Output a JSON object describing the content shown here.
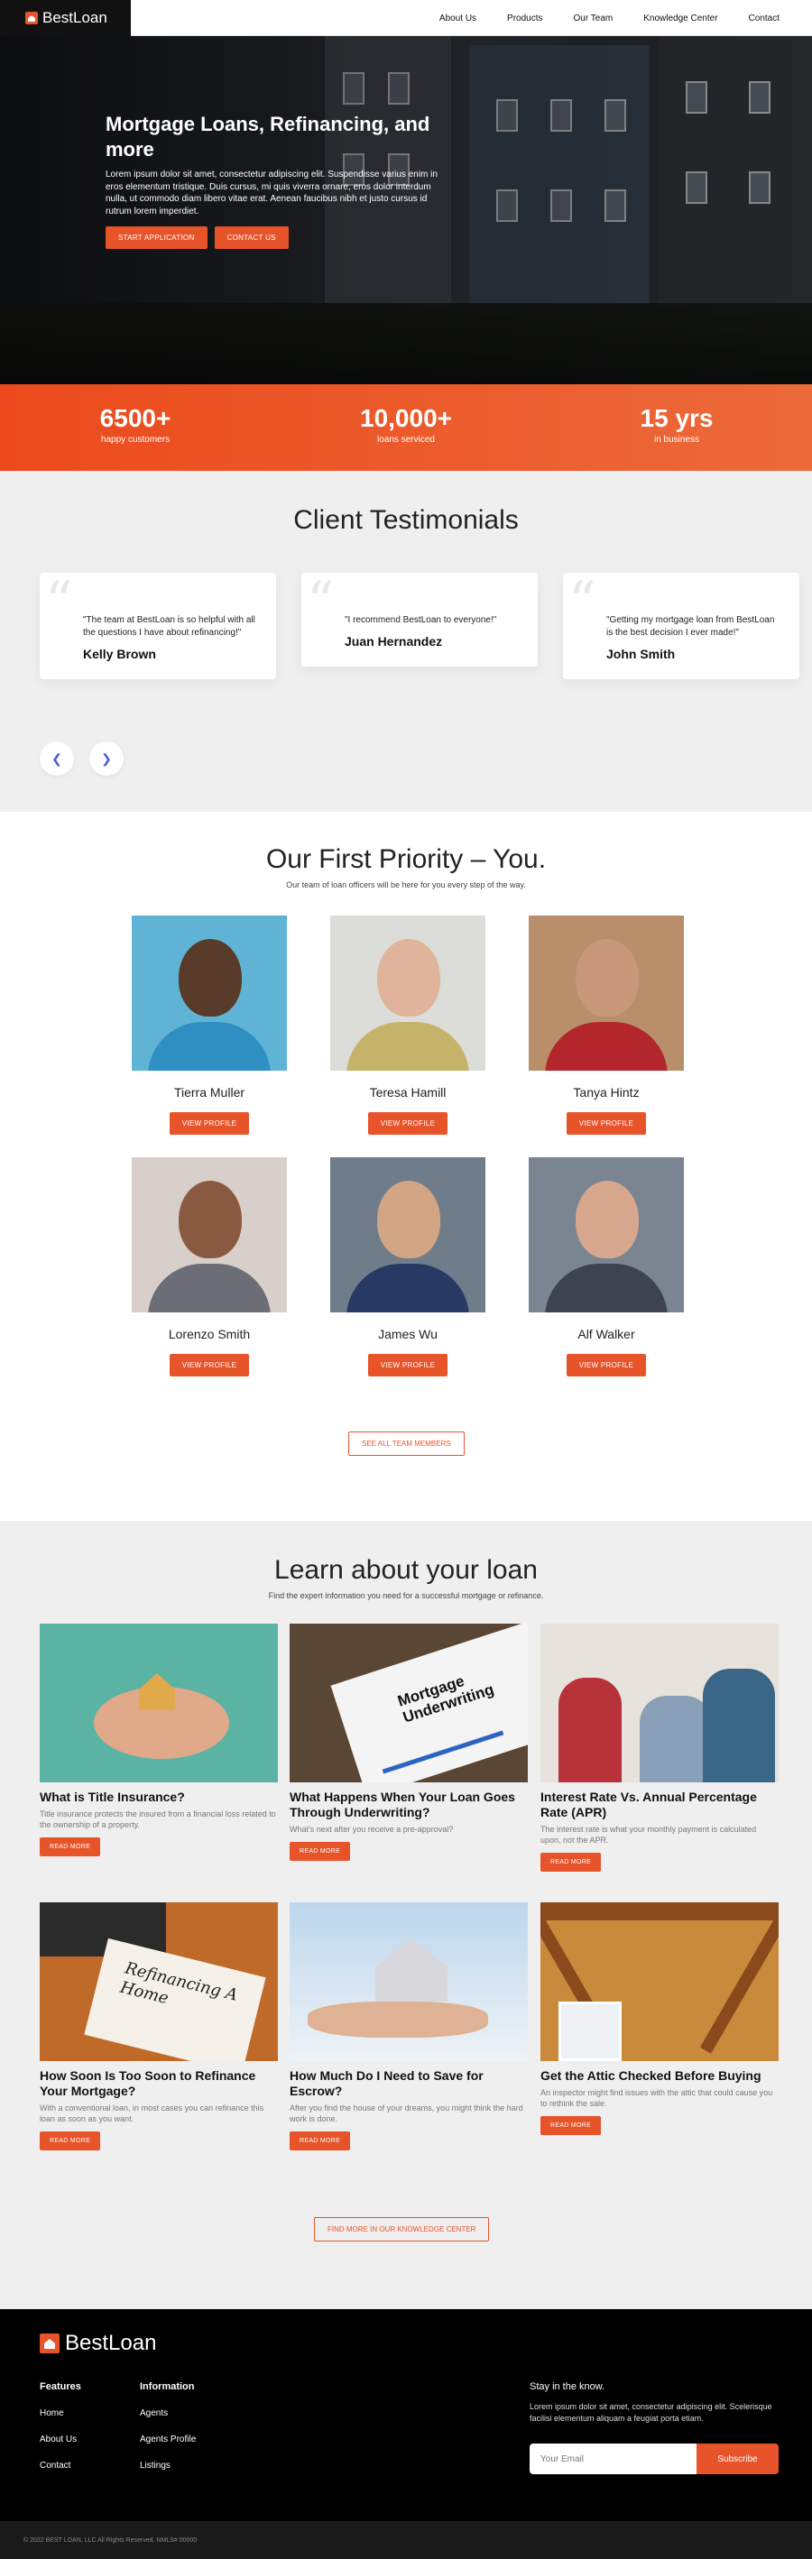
{
  "nav": {
    "brand": "BestLoan",
    "links": [
      "About Us",
      "Products",
      "Our Team",
      "Knowledge Center",
      "Contact"
    ]
  },
  "hero": {
    "title": "Mortgage Loans, Refinancing, and more",
    "text": "Lorem ipsum dolor sit amet, consectetur adipiscing elit. Suspendisse varius enim in eros elementum tristique. Duis cursus, mi quis viverra ornare, eros dolor interdum nulla, ut commodo diam libero vitae erat. Aenean faucibus nibh et justo cursus id rutrum lorem imperdiet.",
    "primary_button": "START APPLICATION",
    "secondary_button": "CONTACT US"
  },
  "stats": [
    {
      "value": "6500+",
      "label": "happy customers"
    },
    {
      "value": "10,000+",
      "label": "loans serviced"
    },
    {
      "value": "15 yrs",
      "label": "in business"
    }
  ],
  "testimonials": {
    "title": "Client Testimonials",
    "items": [
      {
        "quote": "\"The team at BestLoan is so helpful with all the questions I have about refinancing!\"",
        "name": "Kelly Brown"
      },
      {
        "quote": "\"I recommend BestLoan to everyone!\"",
        "name": "Juan Hernandez"
      },
      {
        "quote": "\"Getting my mortgage loan from BestLoan is the best decision I ever made!\"",
        "name": "John Smith"
      }
    ],
    "prev_icon": "chevron-left-icon",
    "next_icon": "chevron-right-icon"
  },
  "team": {
    "title": "Our First Priority – You.",
    "subtitle": "Our team of loan officers will be here for you every step of the way.",
    "members": [
      {
        "name": "Tierra Muller",
        "button": "VIEW PROFILE"
      },
      {
        "name": "Teresa Hamill",
        "button": "VIEW PROFILE"
      },
      {
        "name": "Tanya Hintz",
        "button": "VIEW PROFILE"
      },
      {
        "name": "Lorenzo Smith",
        "button": "VIEW PROFILE"
      },
      {
        "name": "James Wu",
        "button": "VIEW PROFILE"
      },
      {
        "name": "Alf Walker",
        "button": "VIEW PROFILE"
      }
    ],
    "see_all": "SEE ALL TEAM MEMBERS"
  },
  "learn": {
    "title": "Learn about your loan",
    "subtitle": "Find the expert information you need for a successful mortgage or refinance.",
    "articles": [
      {
        "title": "What is Title Insurance?",
        "desc": "Title insurance protects the insured from a financial loss related to the ownership of a property.",
        "button": "READ MORE"
      },
      {
        "title": "What Happens When Your Loan Goes Through Underwriting?",
        "desc": "What's next after you receive a pre-approval?",
        "button": "READ MORE",
        "image_text": "Mortgage Underwriting"
      },
      {
        "title": "Interest Rate Vs. Annual Percentage Rate (APR)",
        "desc": "The interest rate is what your monthly payment is calculated upon, not the APR.",
        "button": "READ MORE"
      },
      {
        "title": "How Soon Is Too Soon to Refinance Your Mortgage?",
        "desc": "With a conventional loan, in most cases you can refinance this loan as soon as you want.",
        "button": "READ MORE",
        "image_text": "Refinancing A Home"
      },
      {
        "title": "How Much Do I Need to Save for Escrow?",
        "desc": "After you find the house of your dreams, you might think the hard work is done.",
        "button": "READ MORE"
      },
      {
        "title": "Get the Attic Checked Before Buying",
        "desc": "An inspector might find issues with the attic that could cause you to rethink the sale.",
        "button": "READ MORE"
      }
    ],
    "find_more": "FIND MORE IN OUR KNOWLEDGE CENTER"
  },
  "footer": {
    "brand": "BestLoan",
    "features_heading": "Features",
    "features": [
      "Home",
      "About Us",
      "Contact"
    ],
    "information_heading": "Information",
    "information": [
      "Agents",
      "Agents Profile",
      "Listings"
    ],
    "newsletter_heading": "Stay in the know.",
    "newsletter_text": "Lorem ipsum dolor sit amet, consectetur adipiscing elit. Scelerisque facilisi elementum aliquam a feugiat porta etiam.",
    "email_placeholder": "Your Email",
    "subscribe": "Subscribe",
    "copyright": "© 2022 BEST LOAN, LLC All Rights Reserved. NMLS# 00000"
  },
  "colors": {
    "accent": "#e8542a",
    "footer_bg": "#000000",
    "section_bg": "#efefef"
  }
}
